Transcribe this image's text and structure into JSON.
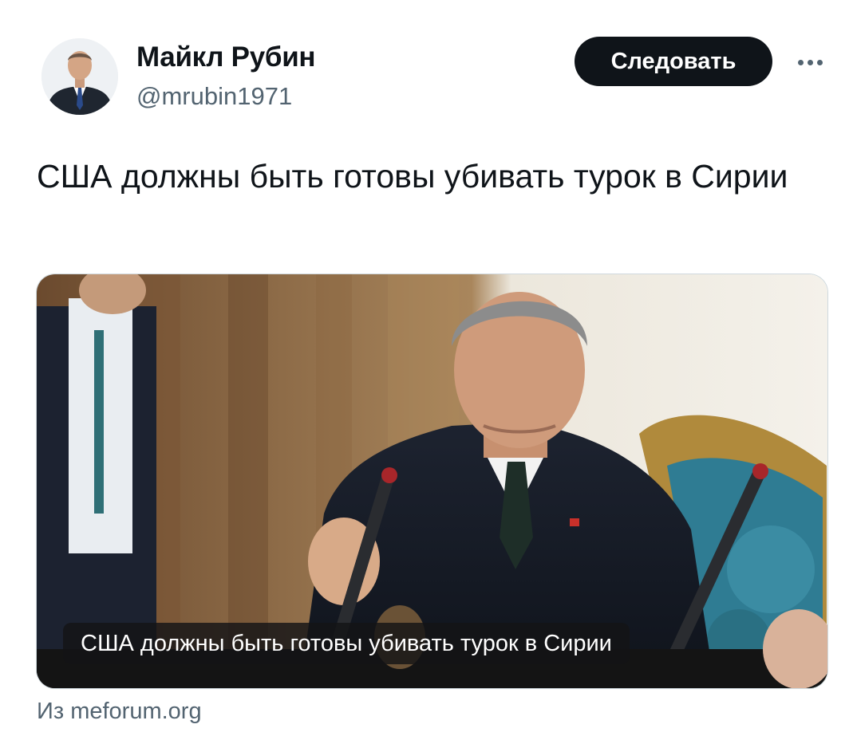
{
  "author": {
    "name": "Майкл Рубин",
    "handle": "@mrubin1971"
  },
  "header": {
    "follow_label": "Следовать",
    "more_icon": "more-horizontal-icon"
  },
  "tweet": {
    "text": "США должны быть готовы убивать турок в Сирии"
  },
  "card": {
    "caption": "США должны быть готовы убивать турок в Сирии"
  },
  "source": {
    "prefix": "Из",
    "domain": "meforum.org"
  },
  "colors": {
    "text_primary": "#0f1419",
    "text_secondary": "#536471",
    "button_bg": "#0f1419",
    "border": "#cfd9de"
  }
}
